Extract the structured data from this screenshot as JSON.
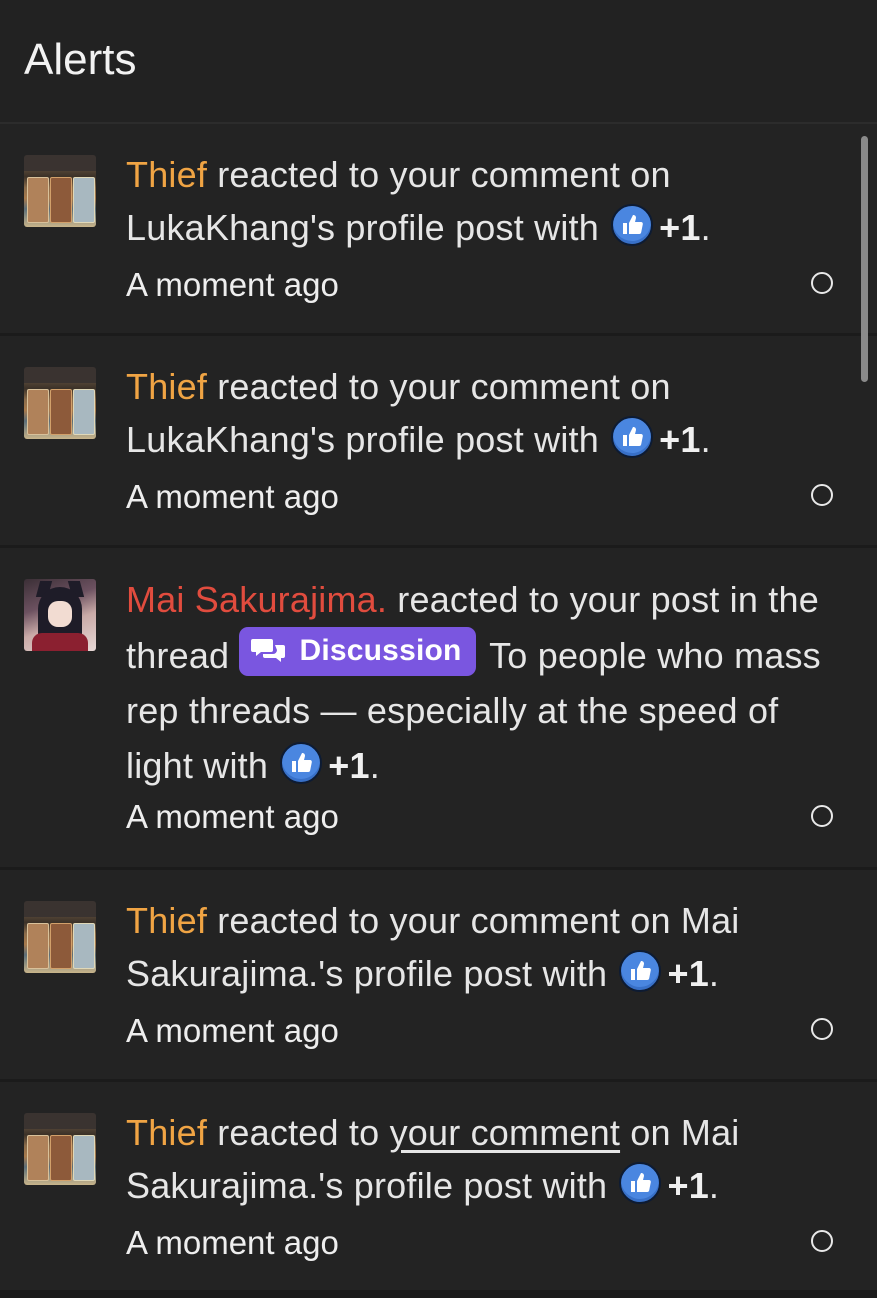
{
  "header": {
    "title": "Alerts"
  },
  "alerts": [
    {
      "user": "Thief",
      "parts": [
        " reacted to your comment on LukaKhang's profile post with "
      ],
      "reaction": "+1",
      "end": ".",
      "time": "A moment ago"
    },
    {
      "user": "Thief",
      "parts": [
        " reacted to your comment on LukaKhang's profile post with "
      ],
      "reaction": "+1",
      "end": ".",
      "time": "A moment ago"
    },
    {
      "user": "Mai Sakurajima.",
      "pre": " reacted to your post in the thread ",
      "badge": "Discussion",
      "thread": " To people who mass rep threads — especially at the speed of light with ",
      "reaction": "+1",
      "end": ".",
      "time": "A moment ago"
    },
    {
      "user": "Thief",
      "parts": [
        " reacted to your comment on Mai Sakurajima.'s profile post with "
      ],
      "reaction": "+1",
      "end": ".",
      "time": "A moment ago"
    },
    {
      "user": "Thief",
      "pre": " reacted to ",
      "link": "your comment",
      "post": " on Mai Sakurajima.'s profile post with ",
      "reaction": "+1",
      "end": ".",
      "time": "A moment ago"
    }
  ],
  "colors": {
    "user_thief": "#f0a444",
    "user_mai": "#e14c3e",
    "badge": "#7a56e0",
    "like": "#4a86e0"
  },
  "icons": [
    "like-reaction-icon",
    "discussion-chat-icon",
    "read-toggle-circle"
  ]
}
